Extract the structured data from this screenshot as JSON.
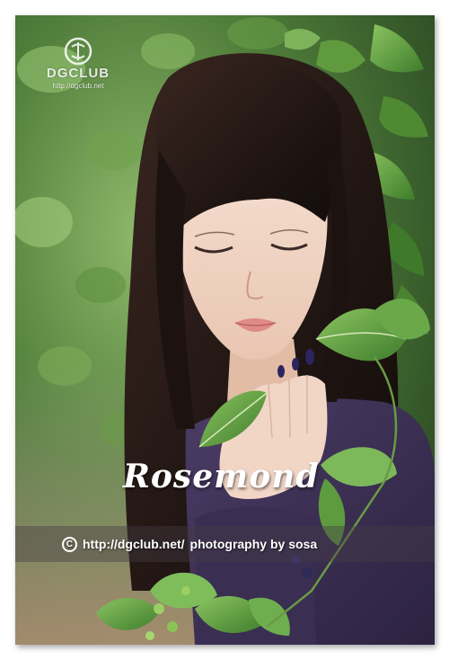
{
  "watermark": {
    "icon": "dgclub-logo-icon",
    "name": "DGCLUB",
    "url": "http://dgclub.net"
  },
  "caption": {
    "title": "Rosemond",
    "credit_icon": "copyright-icon",
    "credit_url": "http://dgclub.net/",
    "credit_text": "photography by sosa"
  },
  "colors": {
    "frame_shadow": "#555555",
    "leaf_green": "#5f9a3e",
    "sweater_purple": "#3b2f52",
    "hair": "#1e1411"
  }
}
